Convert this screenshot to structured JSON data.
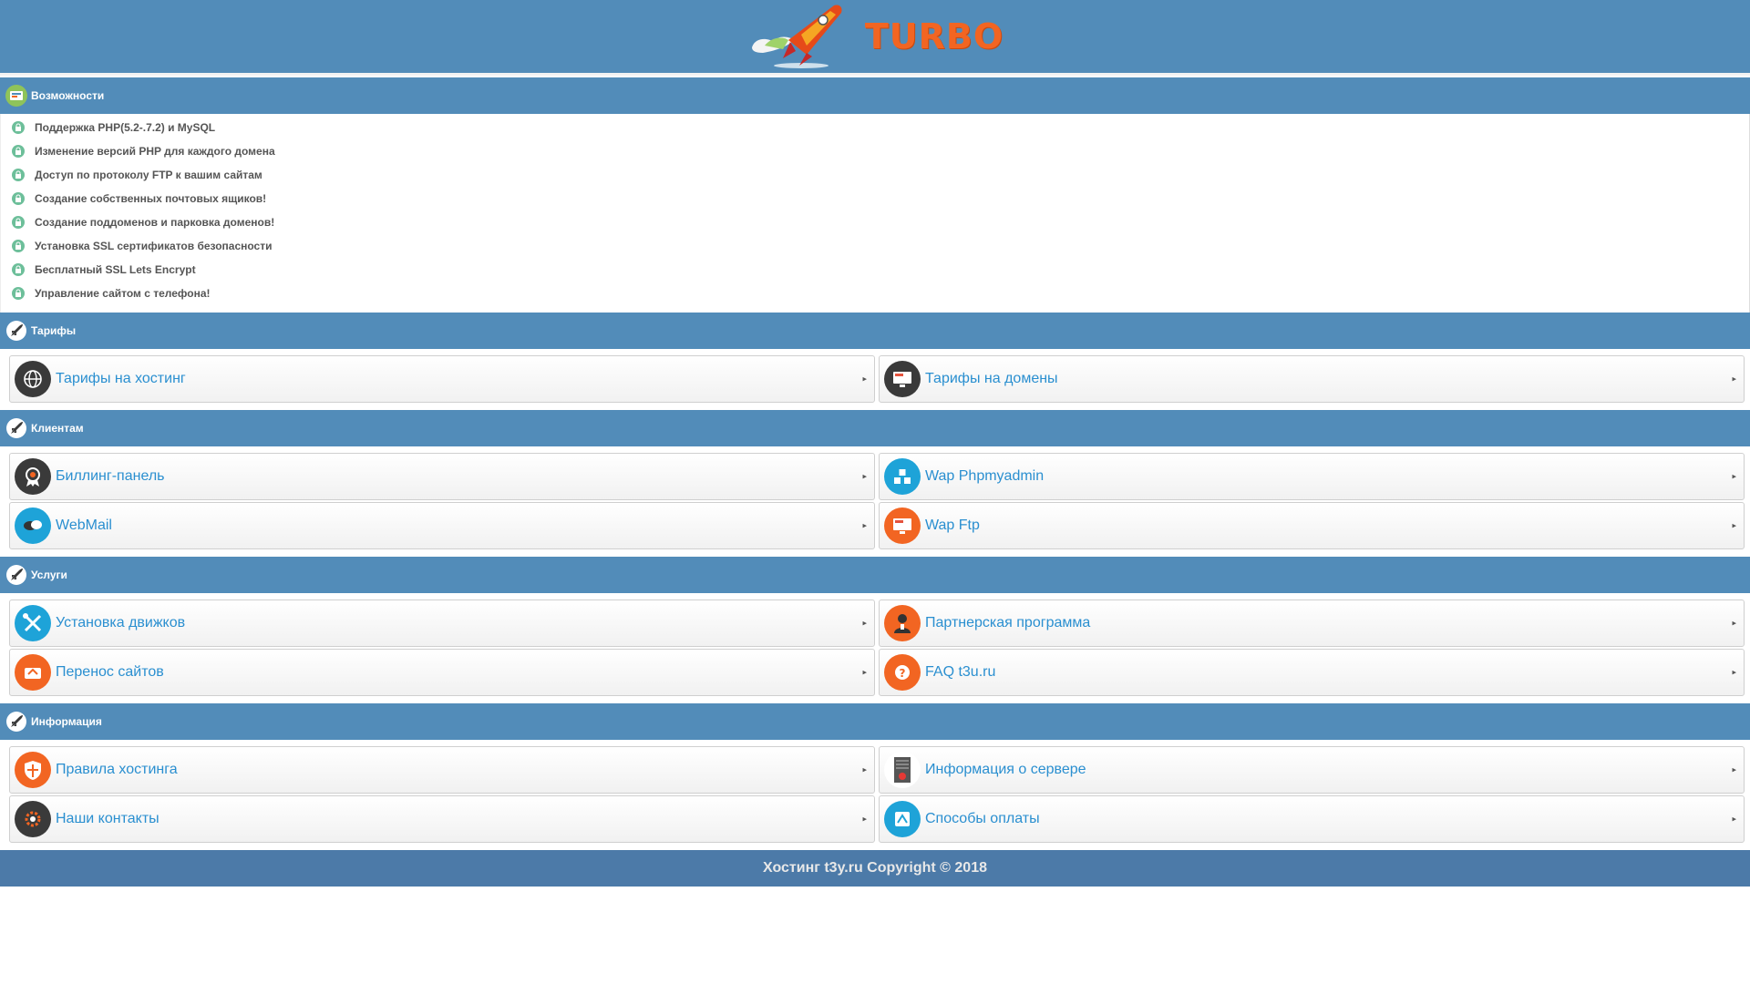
{
  "brand": {
    "name": "TURBO"
  },
  "features_section": {
    "title": "Возможности",
    "items": [
      "Поддержка PHP(5.2-.7.2) и MySQL",
      "Изменение версий PHP для каждого домена",
      "Доступ по протоколу FTP к вашим сайтам",
      "Создание собственных почтовых ящиков!",
      "Создание поддоменов и парковка доменов!",
      "Установка SSL сертификатов безопасности",
      "Бесплатный SSL Lets Encrypt",
      "Управление сайтом с телефона!"
    ]
  },
  "tariffs": {
    "title": "Тарифы",
    "links": [
      {
        "label": "Тарифы на хостинг",
        "icon": "globe-icon",
        "color": "#3a3a3a"
      },
      {
        "label": "Тарифы на домены",
        "icon": "monitor-icon",
        "color": "#3a3a3a"
      }
    ]
  },
  "clients": {
    "title": "Клиентам",
    "links": [
      {
        "label": "Биллинг-панель",
        "icon": "award-icon",
        "color": "#3a3a3a"
      },
      {
        "label": "Wap Phpmyadmin",
        "icon": "database-icon",
        "color": "#1ea3d8"
      },
      {
        "label": "WebMail",
        "icon": "chat-icon",
        "color": "#1ea3d8"
      },
      {
        "label": "Wap Ftp",
        "icon": "monitor-icon",
        "color": "#f26522"
      }
    ]
  },
  "services": {
    "title": "Услуги",
    "links": [
      {
        "label": "Установка движков",
        "icon": "tools-icon",
        "color": "#1ea3d8"
      },
      {
        "label": "Партнерская программа",
        "icon": "person-icon",
        "color": "#f26522"
      },
      {
        "label": "Перенос сайтов",
        "icon": "transfer-icon",
        "color": "#f26522"
      },
      {
        "label": "FAQ t3u.ru",
        "icon": "help-icon",
        "color": "#f26522"
      }
    ]
  },
  "info": {
    "title": "Информация",
    "links": [
      {
        "label": "Правила хостинга",
        "icon": "shield-icon",
        "color": "#f26522"
      },
      {
        "label": "Информация о сервере",
        "icon": "server-icon",
        "color": "#ffffff"
      },
      {
        "label": "Наши контакты",
        "icon": "gear-icon",
        "color": "#3a3a3a"
      },
      {
        "label": "Способы оплаты",
        "icon": "payment-icon",
        "color": "#1ea3d8"
      }
    ]
  },
  "footer": {
    "text": "Хостинг t3y.ru Copyright © 2018"
  }
}
